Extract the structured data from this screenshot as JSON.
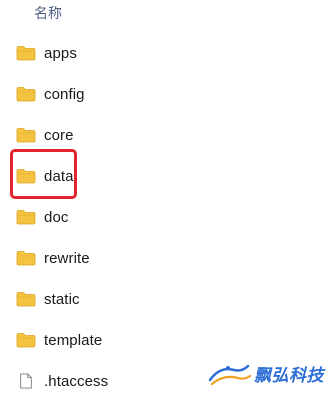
{
  "header": {
    "name_column": "名称"
  },
  "files": [
    {
      "label": "apps",
      "icon": "folder-icon",
      "type": "folder"
    },
    {
      "label": "config",
      "icon": "folder-icon",
      "type": "folder"
    },
    {
      "label": "core",
      "icon": "folder-icon",
      "type": "folder"
    },
    {
      "label": "data",
      "icon": "folder-icon",
      "type": "folder",
      "highlighted": true
    },
    {
      "label": "doc",
      "icon": "folder-icon",
      "type": "folder"
    },
    {
      "label": "rewrite",
      "icon": "folder-icon",
      "type": "folder"
    },
    {
      "label": "static",
      "icon": "folder-icon",
      "type": "folder"
    },
    {
      "label": "template",
      "icon": "folder-icon",
      "type": "folder"
    },
    {
      "label": ".htaccess",
      "icon": "file-icon",
      "type": "file"
    }
  ],
  "highlight_color": "#e0242b",
  "folder_color": "#f5c342",
  "watermark": {
    "text": "飘弘科技",
    "color": "#2d6fd6"
  }
}
